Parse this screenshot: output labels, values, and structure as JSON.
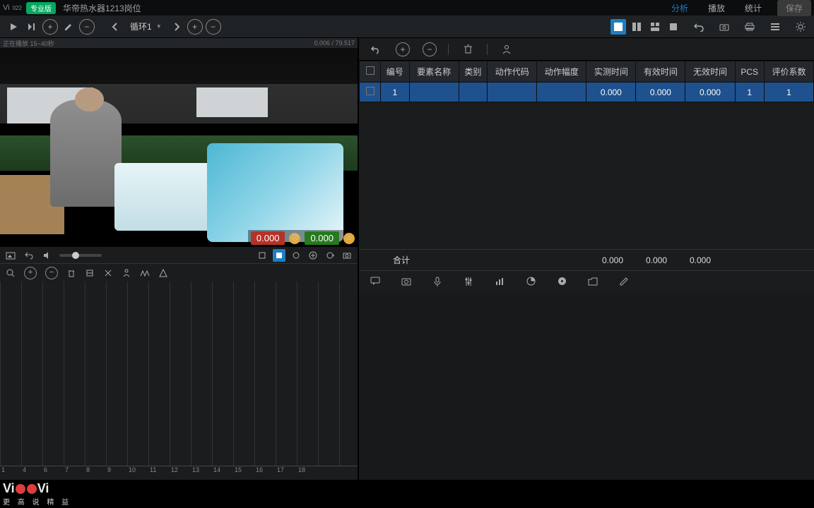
{
  "app": {
    "logo_text": "Vi",
    "logo_year": "022",
    "badge": "专业版",
    "title": "华帝热水器1213岗位",
    "tabs": [
      "分析",
      "播放",
      "统计"
    ],
    "active_tab_index": 0,
    "save_label": "保存"
  },
  "toolbar": {
    "cycle_label": "循环1"
  },
  "video": {
    "header_left": "正在播放 15~40秒",
    "header_right": "0.006 / 79.517",
    "timer_red": "0.000",
    "timer_green": "0.000"
  },
  "table": {
    "columns": [
      "",
      "编号",
      "要素名称",
      "类别",
      "动作代码",
      "动作幅度",
      "实测时间",
      "有效时间",
      "无效时间",
      "PCS",
      "评价系数"
    ],
    "rows": [
      {
        "id": "1",
        "name": "",
        "category": "",
        "action_code": "",
        "amplitude": "",
        "measured": "0.000",
        "valid": "0.000",
        "invalid": "0.000",
        "pcs": "1",
        "coef": "1"
      }
    ],
    "totals_label": "合计",
    "totals": {
      "measured": "0.000",
      "valid": "0.000",
      "invalid": "0.000"
    }
  },
  "timeline": {
    "ticks": [
      "1",
      "4",
      "6",
      "7",
      "8",
      "9",
      "10",
      "11",
      "12",
      "13",
      "14",
      "15",
      "16",
      "17",
      "18"
    ]
  },
  "footer": {
    "brand_left": "Vi",
    "brand_right": "Vi",
    "slogan": "更 高 说 精 益"
  }
}
